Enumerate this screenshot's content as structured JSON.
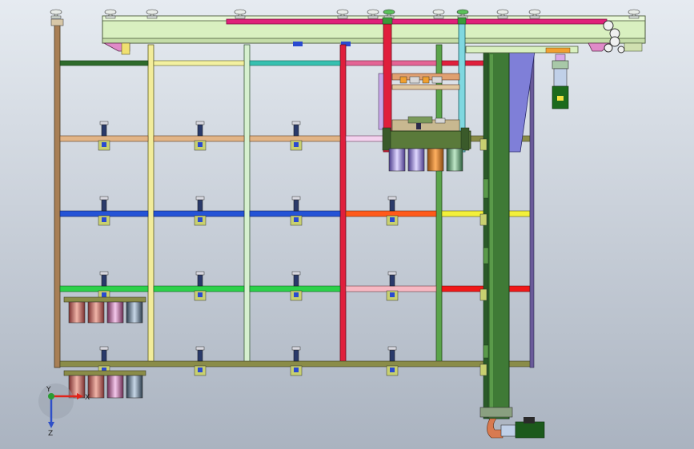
{
  "viewport": {
    "background_top": "#e6ebf1",
    "background_bottom": "#aab3c0"
  },
  "colors": {
    "frame_brown": "#a87f55",
    "post_yellow": "#f2ec9a",
    "post_mint": "#d6f0cf",
    "post_red": "#e01f3c",
    "post_green": "#5aa44a",
    "column_green": "#3f7a36",
    "beam_top": "#d9f0c0",
    "rail_magenta": "#e0207a",
    "tan": "#e2b486",
    "blue": "#2453d6",
    "green": "#2cd14a",
    "olive": "#8a8c48",
    "orange_red": "#ff5a1a",
    "yellow": "#f3f03a",
    "pink": "#f7b8c2",
    "red": "#f01818",
    "lavender": "#f3d2ee",
    "sky": "#5fc6d8",
    "dark_green_beam": "#2f6b2c",
    "pinkish": "#e46495",
    "brace_purple": "#7f7fd8"
  },
  "triad": {
    "x_label": "X",
    "y_label": "Y",
    "z_label": "Z",
    "x_color": "#e0241b",
    "y_color": "#2a9c32",
    "z_color": "#2f50c8"
  }
}
